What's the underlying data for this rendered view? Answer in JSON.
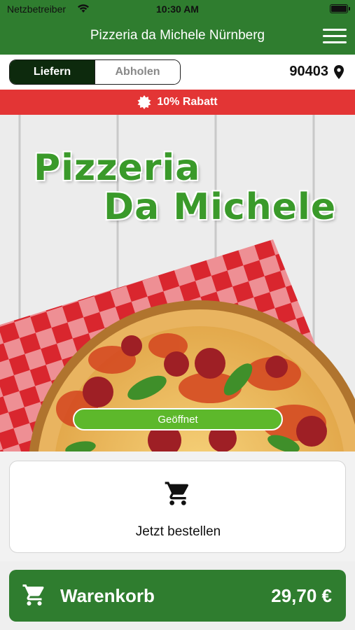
{
  "status_bar": {
    "carrier": "Netzbetreiber",
    "time": "10:30 AM",
    "icons": [
      "wifi-icon",
      "battery-icon"
    ]
  },
  "header": {
    "title": "Pizzeria da Michele Nürnberg",
    "menu_icon": "hamburger-menu-icon",
    "bg_color": "#2f7d2f"
  },
  "delivery_mode": {
    "options": [
      {
        "label": "Liefern",
        "selected": true
      },
      {
        "label": "Abholen",
        "selected": false
      }
    ],
    "zip_code": "90403",
    "zip_icon": "location-pin-icon"
  },
  "promo": {
    "text": "10% Rabatt",
    "icon": "badge-icon",
    "bg_color": "#e33535"
  },
  "hero": {
    "logo_line1": "Pizzeria",
    "logo_line2": "Da Michele",
    "status": "Geöffnet",
    "status_color": "#5db82b"
  },
  "order_card": {
    "icon": "shopping-cart-icon",
    "label": "Jetzt bestellen"
  },
  "cart_bar": {
    "icon": "shopping-cart-icon",
    "label": "Warenkorb",
    "total": "29,70 €"
  }
}
